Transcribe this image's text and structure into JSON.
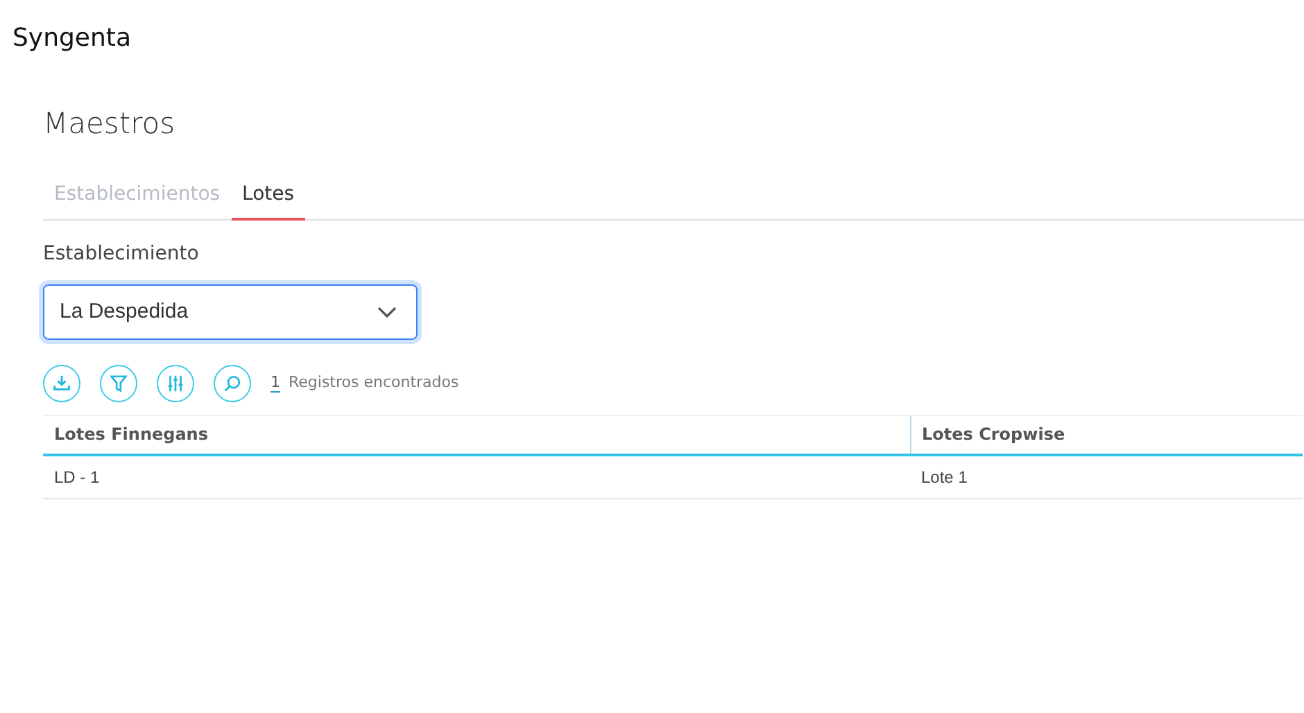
{
  "brand": "Syngenta",
  "page_title": "Maestros",
  "tabs": [
    {
      "label": "Establecimientos",
      "selected": false
    },
    {
      "label": "Lotes",
      "selected": true
    }
  ],
  "field": {
    "label": "Establecimiento",
    "value": "La Despedida"
  },
  "toolbar": [
    {
      "kind": "download"
    },
    {
      "kind": "filter"
    },
    {
      "kind": "columns"
    },
    {
      "kind": "search"
    }
  ],
  "record_count": "1",
  "record_text": "Registros encontrados",
  "table": {
    "columns": [
      "Lotes Finnegans",
      "Lotes Cropwise"
    ],
    "rows": [
      [
        "LD - 1",
        "Lote 1"
      ]
    ]
  }
}
